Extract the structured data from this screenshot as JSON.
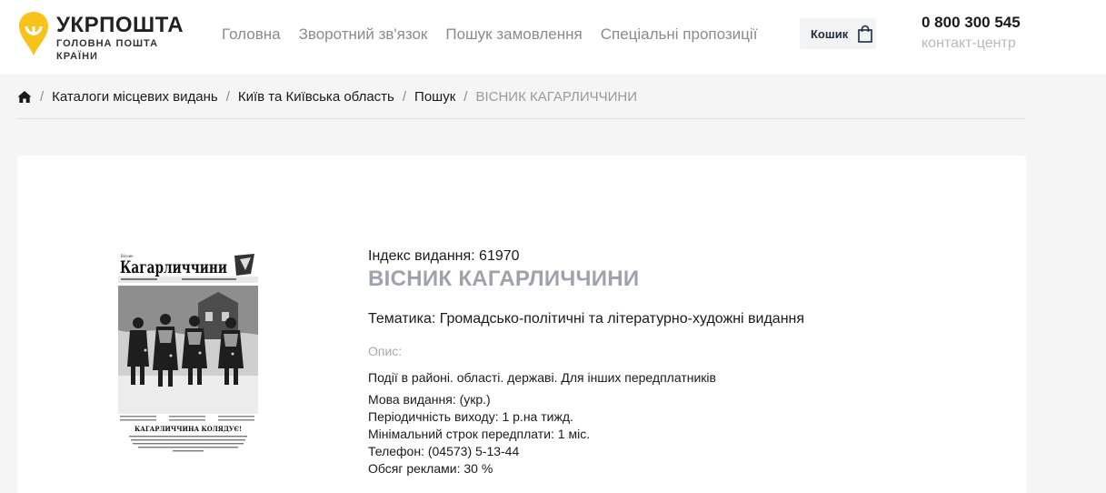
{
  "header": {
    "logo": {
      "name": "УКРПОШТА",
      "tagline": "ГОЛОВНА ПОШТА КРАЇНИ",
      "brand_color": "#f7c31a"
    },
    "nav": [
      {
        "label": "Головна"
      },
      {
        "label": "Зворотний зв'язок"
      },
      {
        "label": "Пошук замовлення"
      },
      {
        "label": "Спеціальні пропозиції"
      }
    ],
    "cart": {
      "label": "Кошик",
      "icon": "shopping-bag-icon"
    },
    "contact": {
      "phone": "0 800 300 545",
      "label": "контакт-центр"
    }
  },
  "breadcrumb": {
    "home_icon": "home-icon",
    "items": [
      {
        "label": "Каталоги місцевих видань"
      },
      {
        "label": "Київ та Київська область"
      },
      {
        "label": "Пошук"
      }
    ],
    "current": "ВІСНИК КАГАРЛИЧЧИНИ",
    "separator": "/"
  },
  "publication": {
    "cover": {
      "masthead": "Кагарличчини",
      "headline": "КАГАРЛИЧЧИНА КОЛЯДУЄ!"
    },
    "index_line": "Індекс видання: 61970",
    "title": "ВІСНИК КАГАРЛИЧЧИНИ",
    "theme_line": "Тематика: Громадсько-політичні та літературно-художні видання",
    "description_label": "Опис:",
    "description": "Події в районі. області. державі. Для інших передплатників",
    "details": [
      "Мова видання: (укр.)",
      "Періодичність виходу: 1 р.на тижд.",
      "Мінімальний строк передплати: 1 міс.",
      "Телефон: (04573) 5-13-44",
      "Обсяг реклами: 30 %"
    ]
  }
}
